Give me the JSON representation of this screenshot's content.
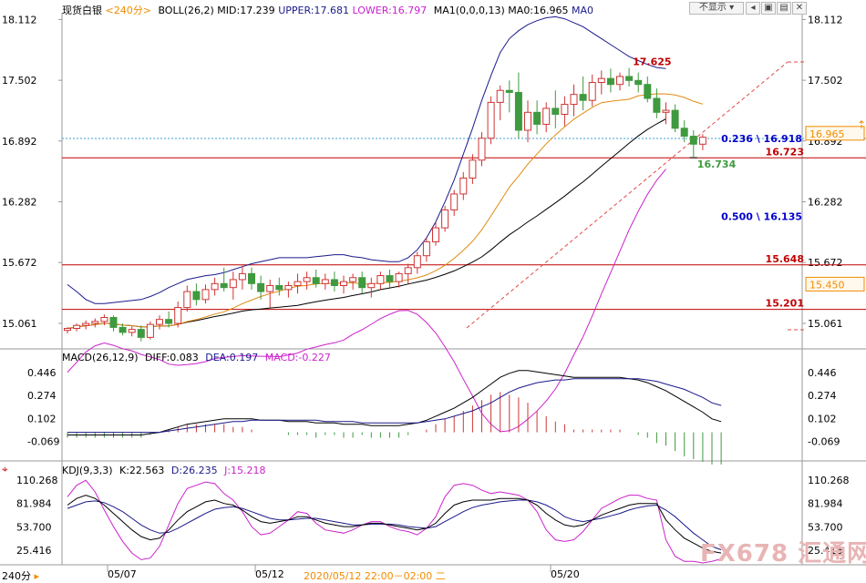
{
  "header": {
    "symbol": "现货白银",
    "period": "<240分>",
    "boll": "BOLL(26,2)",
    "boll_mid": "MID:17.239",
    "boll_upper": "UPPER:17.681",
    "boll_lower": "LOWER:16.797",
    "ma": "MA1(0,0,0,13)",
    "ma0": "MA0:16.965",
    "ma0_short": "MA0"
  },
  "controls": {
    "hide": "不显示",
    "btn1": "◂",
    "btn2": "▣",
    "btn3": "▤",
    "btn4": "✕"
  },
  "macd_header": {
    "title": "MACD(26,12,9)",
    "diff": "DIFF:0.083",
    "dea": "DEA:0.197",
    "macd": "MACD:-0.227"
  },
  "kdj_header": {
    "title": "KDJ(9,3,3)",
    "k": "K:22.563",
    "d": "D:26.235",
    "j": "J:15.218"
  },
  "bottom_bar": {
    "period": "240分",
    "dates": [
      "05/07",
      "05/12",
      "05/20"
    ],
    "cursor_info": "2020/05/12 22:00－02:00 二"
  },
  "watermark": {
    "code": "FX678",
    "name": "汇通网"
  },
  "colors": {
    "up": "#d03434",
    "down": "#3f9a3f",
    "boll_upper": "#1a1a8a",
    "boll_mid": "#000000",
    "boll_lower": "#cc22cc",
    "ma0": "#e08a10",
    "hline": "#c00000",
    "fib": "#0000cc",
    "accent": "#f08c00"
  },
  "chart_data": [
    {
      "type": "candlestick",
      "ylim": [
        14.85,
        18.18
      ],
      "yticks": [
        "18.112",
        "17.502",
        "16.892",
        "16.282",
        "15.672",
        "15.061"
      ],
      "candles": [
        [
          14.99,
          15.02,
          14.96,
          15.01
        ],
        [
          15.01,
          15.06,
          14.98,
          15.04
        ],
        [
          15.04,
          15.09,
          15.0,
          15.06
        ],
        [
          15.06,
          15.11,
          15.02,
          15.08
        ],
        [
          15.08,
          15.15,
          15.04,
          15.12
        ],
        [
          15.12,
          15.14,
          14.98,
          15.02
        ],
        [
          15.02,
          15.06,
          14.94,
          14.97
        ],
        [
          14.97,
          15.03,
          14.93,
          15.0
        ],
        [
          15.0,
          15.04,
          14.88,
          14.92
        ],
        [
          14.92,
          15.08,
          14.9,
          15.05
        ],
        [
          15.05,
          15.14,
          15.0,
          15.1
        ],
        [
          15.1,
          15.18,
          15.02,
          15.06
        ],
        [
          15.06,
          15.28,
          15.02,
          15.22
        ],
        [
          15.22,
          15.44,
          15.18,
          15.38
        ],
        [
          15.38,
          15.46,
          15.24,
          15.3
        ],
        [
          15.3,
          15.45,
          15.26,
          15.4
        ],
        [
          15.4,
          15.52,
          15.34,
          15.46
        ],
        [
          15.46,
          15.62,
          15.38,
          15.42
        ],
        [
          15.42,
          15.58,
          15.3,
          15.5
        ],
        [
          15.5,
          15.64,
          15.4,
          15.56
        ],
        [
          15.56,
          15.62,
          15.4,
          15.46
        ],
        [
          15.46,
          15.54,
          15.3,
          15.38
        ],
        [
          15.38,
          15.5,
          15.22,
          15.44
        ],
        [
          15.44,
          15.52,
          15.34,
          15.4
        ],
        [
          15.4,
          15.48,
          15.32,
          15.44
        ],
        [
          15.44,
          15.56,
          15.36,
          15.48
        ],
        [
          15.48,
          15.58,
          15.4,
          15.52
        ],
        [
          15.52,
          15.6,
          15.42,
          15.46
        ],
        [
          15.46,
          15.56,
          15.4,
          15.5
        ],
        [
          15.5,
          15.58,
          15.38,
          15.44
        ],
        [
          15.44,
          15.54,
          15.36,
          15.48
        ],
        [
          15.48,
          15.56,
          15.4,
          15.52
        ],
        [
          15.52,
          15.58,
          15.36,
          15.42
        ],
        [
          15.42,
          15.52,
          15.32,
          15.46
        ],
        [
          15.46,
          15.58,
          15.4,
          15.54
        ],
        [
          15.54,
          15.6,
          15.42,
          15.48
        ],
        [
          15.48,
          15.58,
          15.42,
          15.56
        ],
        [
          15.56,
          15.66,
          15.46,
          15.62
        ],
        [
          15.62,
          15.78,
          15.56,
          15.74
        ],
        [
          15.74,
          15.92,
          15.68,
          15.88
        ],
        [
          15.88,
          16.08,
          15.84,
          16.02
        ],
        [
          16.02,
          16.24,
          15.98,
          16.2
        ],
        [
          16.2,
          16.4,
          16.14,
          16.36
        ],
        [
          16.36,
          16.58,
          16.3,
          16.52
        ],
        [
          16.52,
          16.76,
          16.46,
          16.7
        ],
        [
          16.7,
          16.98,
          16.64,
          16.92
        ],
        [
          16.92,
          17.34,
          16.86,
          17.28
        ],
        [
          17.28,
          17.45,
          17.1,
          17.4
        ],
        [
          17.4,
          17.5,
          17.18,
          17.38
        ],
        [
          17.38,
          17.58,
          16.92,
          17.0
        ],
        [
          17.0,
          17.3,
          16.88,
          17.18
        ],
        [
          17.18,
          17.3,
          16.96,
          17.06
        ],
        [
          17.06,
          17.28,
          16.98,
          17.22
        ],
        [
          17.22,
          17.4,
          17.02,
          17.16
        ],
        [
          17.16,
          17.34,
          17.04,
          17.26
        ],
        [
          17.26,
          17.46,
          17.14,
          17.36
        ],
        [
          17.36,
          17.54,
          17.2,
          17.3
        ],
        [
          17.3,
          17.56,
          17.24,
          17.48
        ],
        [
          17.48,
          17.6,
          17.36,
          17.52
        ],
        [
          17.52,
          17.62,
          17.38,
          17.46
        ],
        [
          17.46,
          17.58,
          17.4,
          17.54
        ],
        [
          17.54,
          17.625,
          17.44,
          17.5
        ],
        [
          17.5,
          17.58,
          17.38,
          17.46
        ],
        [
          17.46,
          17.54,
          17.28,
          17.32
        ],
        [
          17.32,
          17.42,
          17.12,
          17.18
        ],
        [
          17.18,
          17.28,
          17.06,
          17.2
        ],
        [
          17.2,
          17.26,
          16.98,
          17.02
        ],
        [
          17.02,
          17.1,
          16.88,
          16.94
        ],
        [
          16.94,
          17.0,
          16.734,
          16.86
        ],
        [
          16.86,
          16.96,
          16.8,
          16.93
        ]
      ],
      "boll_upper": [
        15.45,
        15.38,
        15.3,
        15.26,
        15.26,
        15.27,
        15.28,
        15.29,
        15.3,
        15.33,
        15.37,
        15.42,
        15.46,
        15.5,
        15.52,
        15.54,
        15.55,
        15.57,
        15.6,
        15.63,
        15.66,
        15.68,
        15.7,
        15.72,
        15.72,
        15.72,
        15.72,
        15.73,
        15.74,
        15.75,
        15.75,
        15.73,
        15.72,
        15.7,
        15.69,
        15.68,
        15.68,
        15.72,
        15.8,
        15.92,
        16.08,
        16.28,
        16.5,
        16.76,
        17.02,
        17.3,
        17.55,
        17.78,
        17.92,
        18.0,
        18.06,
        18.1,
        18.13,
        18.14,
        18.12,
        18.08,
        18.04,
        17.98,
        17.92,
        17.86,
        17.8,
        17.74,
        17.7,
        17.66,
        17.63,
        17.62
      ]
    },
    {
      "type": "macd",
      "ylim": [
        -0.2,
        0.52
      ],
      "yticks": [
        "0.446",
        "0.274",
        "0.102",
        "-0.069"
      ],
      "diff": [
        -0.02,
        -0.02,
        -0.02,
        -0.02,
        -0.02,
        -0.02,
        -0.02,
        -0.02,
        -0.02,
        -0.01,
        0.0,
        0.02,
        0.04,
        0.06,
        0.07,
        0.08,
        0.09,
        0.1,
        0.1,
        0.1,
        0.1,
        0.09,
        0.09,
        0.09,
        0.08,
        0.08,
        0.08,
        0.07,
        0.07,
        0.07,
        0.06,
        0.06,
        0.06,
        0.05,
        0.05,
        0.05,
        0.05,
        0.06,
        0.07,
        0.09,
        0.12,
        0.15,
        0.18,
        0.22,
        0.26,
        0.31,
        0.36,
        0.41,
        0.44,
        0.46,
        0.46,
        0.45,
        0.44,
        0.43,
        0.42,
        0.41,
        0.41,
        0.41,
        0.41,
        0.41,
        0.41,
        0.4,
        0.39,
        0.37,
        0.34,
        0.31,
        0.27,
        0.23,
        0.19,
        0.15,
        0.1,
        0.08
      ],
      "dea": [
        0.0,
        0.0,
        0.0,
        0.0,
        0.0,
        0.0,
        0.0,
        0.0,
        0.0,
        0.0,
        0.0,
        0.01,
        0.02,
        0.03,
        0.04,
        0.05,
        0.06,
        0.07,
        0.08,
        0.08,
        0.09,
        0.09,
        0.09,
        0.09,
        0.09,
        0.09,
        0.09,
        0.09,
        0.08,
        0.08,
        0.08,
        0.08,
        0.07,
        0.07,
        0.07,
        0.07,
        0.07,
        0.07,
        0.07,
        0.08,
        0.09,
        0.1,
        0.12,
        0.14,
        0.16,
        0.19,
        0.22,
        0.26,
        0.3,
        0.33,
        0.35,
        0.37,
        0.38,
        0.39,
        0.39,
        0.4,
        0.4,
        0.4,
        0.4,
        0.4,
        0.4,
        0.4,
        0.4,
        0.39,
        0.38,
        0.36,
        0.34,
        0.32,
        0.29,
        0.26,
        0.22,
        0.2
      ]
    },
    {
      "type": "kdj",
      "ylim": [
        10,
        118
      ],
      "yticks": [
        "110.268",
        "81.984",
        "53.700",
        "25.416"
      ],
      "k": [
        80,
        88,
        92,
        88,
        80,
        70,
        60,
        50,
        42,
        38,
        40,
        50,
        62,
        72,
        78,
        84,
        86,
        82,
        80,
        74,
        66,
        60,
        58,
        60,
        62,
        66,
        66,
        62,
        58,
        56,
        54,
        54,
        56,
        58,
        58,
        56,
        54,
        52,
        50,
        52,
        58,
        70,
        80,
        84,
        86,
        86,
        86,
        88,
        88,
        88,
        86,
        80,
        70,
        62,
        56,
        54,
        56,
        62,
        68,
        72,
        76,
        80,
        82,
        82,
        82,
        62,
        50,
        40,
        34,
        28,
        24,
        22
      ],
      "d": [
        76,
        80,
        84,
        85,
        83,
        78,
        72,
        64,
        56,
        50,
        46,
        47,
        52,
        58,
        64,
        70,
        75,
        77,
        78,
        76,
        72,
        68,
        64,
        62,
        62,
        63,
        64,
        64,
        62,
        60,
        58,
        56,
        56,
        57,
        57,
        57,
        56,
        54,
        53,
        52,
        54,
        60,
        66,
        72,
        77,
        80,
        82,
        84,
        85,
        86,
        86,
        84,
        80,
        74,
        66,
        62,
        60,
        62,
        64,
        67,
        70,
        74,
        77,
        79,
        80,
        74,
        66,
        56,
        46,
        38,
        30,
        26
      ],
      "j": [
        90,
        104,
        110,
        96,
        74,
        54,
        36,
        22,
        14,
        16,
        30,
        56,
        82,
        100,
        104,
        108,
        106,
        94,
        86,
        72,
        54,
        44,
        46,
        54,
        62,
        72,
        70,
        58,
        50,
        48,
        46,
        50,
        56,
        60,
        60,
        54,
        50,
        48,
        44,
        52,
        66,
        90,
        104,
        106,
        104,
        98,
        94,
        96,
        94,
        92,
        86,
        72,
        50,
        38,
        36,
        38,
        48,
        62,
        76,
        82,
        88,
        92,
        92,
        88,
        86,
        38,
        18,
        12,
        12,
        10,
        12,
        15
      ]
    }
  ],
  "price_levels": [
    {
      "value": 16.723,
      "label": "16.723"
    },
    {
      "value": 15.648,
      "label": "15.648"
    },
    {
      "value": 15.201,
      "label": "15.201"
    }
  ],
  "fib_labels": [
    {
      "value": 16.918,
      "label": "0.236 \\ 16.918"
    },
    {
      "value": 16.135,
      "label": "0.500 \\ 16.135"
    }
  ],
  "price_tags": [
    {
      "value": 16.965,
      "label": "16.965"
    },
    {
      "value": 15.45,
      "label": "15.450"
    }
  ],
  "annotations": [
    {
      "value": 17.625,
      "label": "17.625"
    },
    {
      "value": 16.734,
      "label": "16.734"
    }
  ]
}
